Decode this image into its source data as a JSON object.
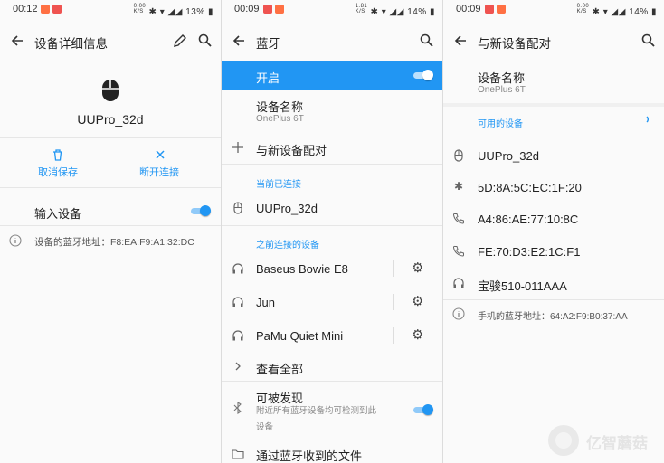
{
  "panel1": {
    "status": {
      "time": "00:12",
      "net_speed_top": "0.00",
      "net_speed_unit": "K/S",
      "battery": "13%"
    },
    "title": "设备详细信息",
    "device_name": "UUPro_32d",
    "actions": {
      "forget_label": "取消保存",
      "disconnect_label": "断开连接"
    },
    "input_device_label": "输入设备",
    "bt_address_text": "设备的蓝牙地址：F8:EA:F9:A1:32:DC"
  },
  "panel2": {
    "status": {
      "time": "00:09",
      "net_speed_top": "1.81",
      "net_speed_unit": "K/S",
      "battery": "14%"
    },
    "title": "蓝牙",
    "toggle_label": "开启",
    "device_name_title": "设备名称",
    "device_name_value": "OnePlus 6T",
    "pair_new": "与新设备配对",
    "connected_header": "当前已连接",
    "connected_device": "UUPro_32d",
    "previous_header": "之前连接的设备",
    "previous_devices": [
      "Baseus Bowie E8",
      "Jun",
      "PaMu Quiet Mini"
    ],
    "see_all": "查看全部",
    "discoverable_title": "可被发现",
    "discoverable_desc_line1": "附近所有蓝牙设备均可检测到此",
    "discoverable_desc_line2": "设备",
    "received_files": "通过蓝牙收到的文件"
  },
  "panel3": {
    "status": {
      "time": "00:09",
      "net_speed_top": "0.00",
      "net_speed_unit": "K/S",
      "battery": "14%"
    },
    "title": "与新设备配对",
    "device_name_title": "设备名称",
    "device_name_value": "OnePlus 6T",
    "available_header": "可用的设备",
    "devices": [
      "UUPro_32d",
      "5D:8A:5C:EC:1F:20",
      "A4:86:AE:77:10:8C",
      "FE:70:D3:E2:1C:F1",
      "宝骏510-011AAA"
    ],
    "bt_address_text": "手机的蓝牙地址：64:A2:F9:B0:37:AA"
  },
  "watermark_text": "亿智蘑菇",
  "colors": {
    "accent": "#2196f3",
    "background": "#fafafa",
    "divider": "#e6e6e6"
  }
}
